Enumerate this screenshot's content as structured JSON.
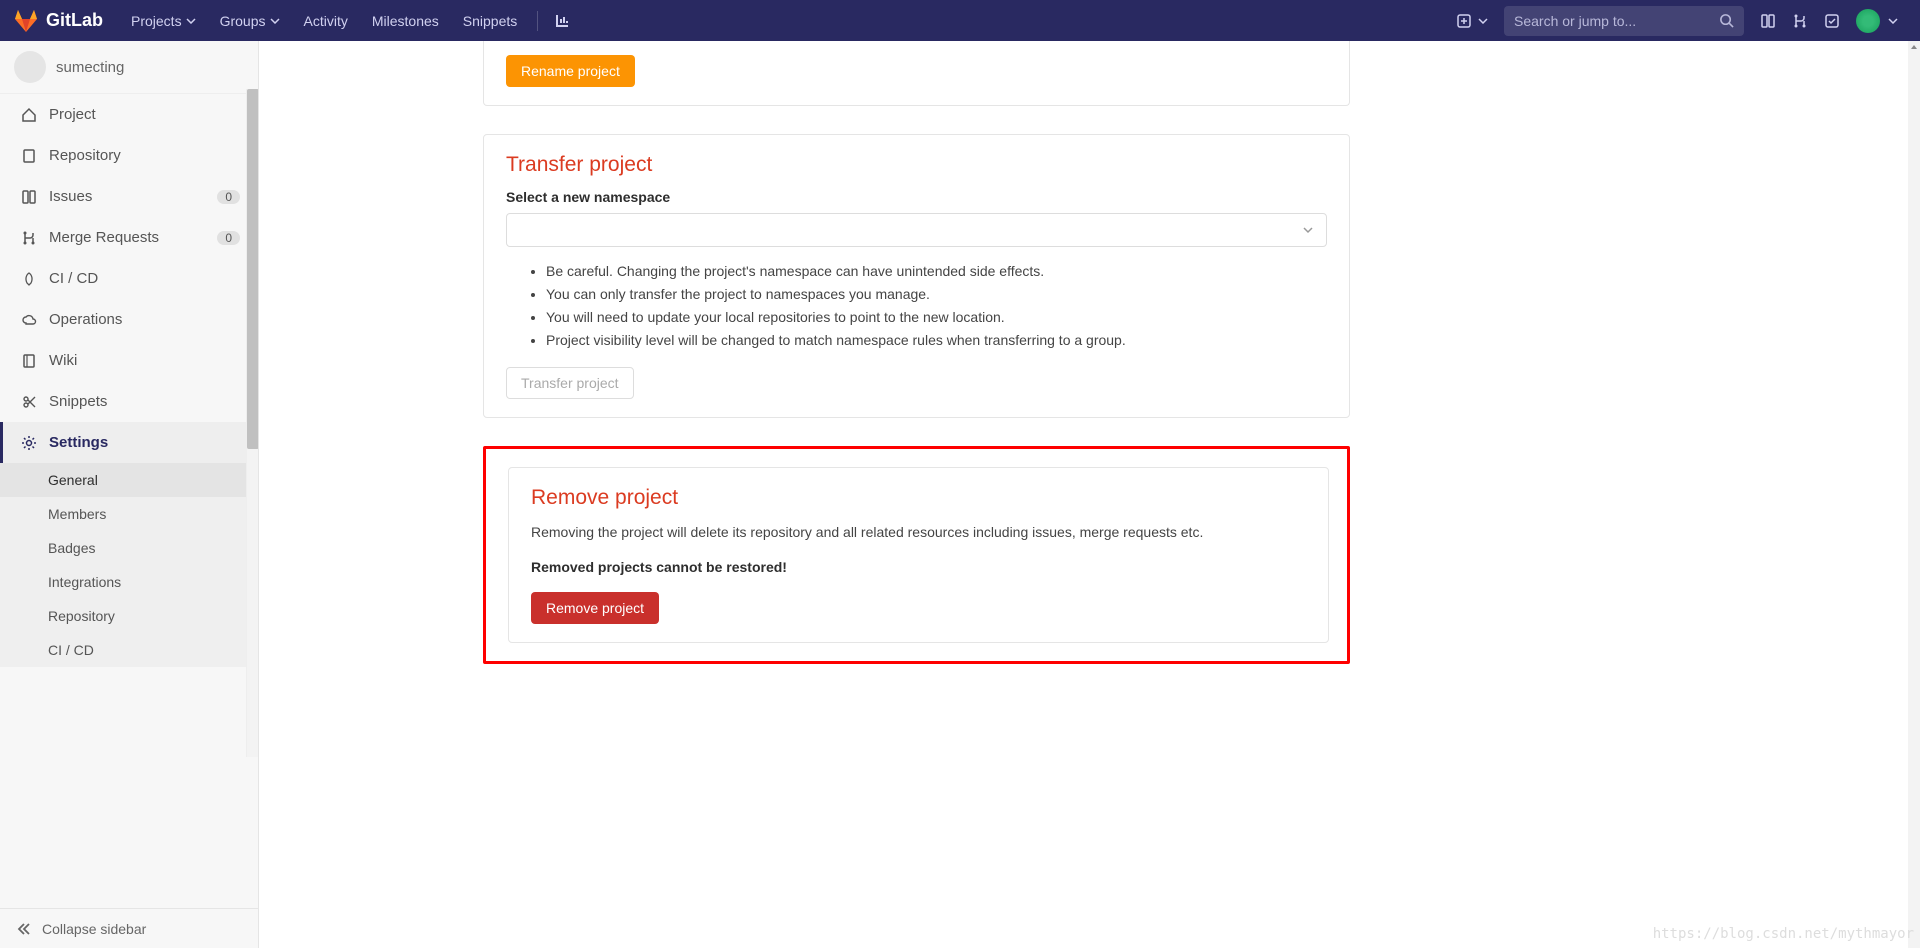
{
  "navbar": {
    "brand": "GitLab",
    "items": [
      "Projects",
      "Groups",
      "Activity",
      "Milestones",
      "Snippets"
    ],
    "search_placeholder": "Search or jump to..."
  },
  "sidebar": {
    "project_name": "sumecting",
    "items": [
      {
        "label": "Project",
        "icon": "home"
      },
      {
        "label": "Repository",
        "icon": "file"
      },
      {
        "label": "Issues",
        "icon": "board",
        "badge": "0"
      },
      {
        "label": "Merge Requests",
        "icon": "merge",
        "badge": "0"
      },
      {
        "label": "CI / CD",
        "icon": "rocket"
      },
      {
        "label": "Operations",
        "icon": "cloud"
      },
      {
        "label": "Wiki",
        "icon": "book"
      },
      {
        "label": "Snippets",
        "icon": "scissors"
      },
      {
        "label": "Settings",
        "icon": "gear",
        "active": true
      }
    ],
    "settings_sub": [
      "General",
      "Members",
      "Badges",
      "Integrations",
      "Repository",
      "CI / CD"
    ],
    "collapse": "Collapse sidebar"
  },
  "content": {
    "rename_btn": "Rename project",
    "transfer": {
      "title": "Transfer project",
      "select_label": "Select a new namespace",
      "bullets": [
        "Be careful. Changing the project's namespace can have unintended side effects.",
        "You can only transfer the project to namespaces you manage.",
        "You will need to update your local repositories to point to the new location.",
        "Project visibility level will be changed to match namespace rules when transferring to a group."
      ],
      "btn": "Transfer project"
    },
    "remove": {
      "title": "Remove project",
      "desc": "Removing the project will delete its repository and all related resources including issues, merge requests etc.",
      "warn": "Removed projects cannot be restored!",
      "btn": "Remove project"
    }
  },
  "watermark": "https://blog.csdn.net/mythmayor"
}
